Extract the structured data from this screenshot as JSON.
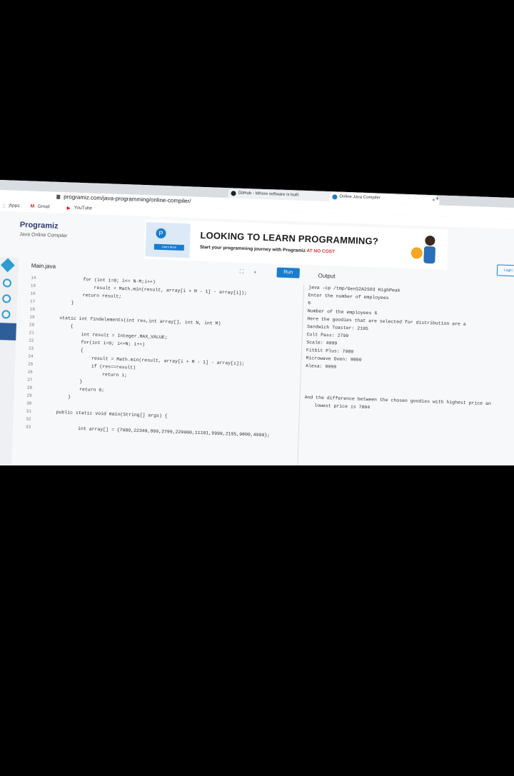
{
  "browser": {
    "tabs": [
      {
        "label": "GitHub - Where software is built"
      },
      {
        "label": "Online Java Compiler"
      }
    ],
    "url": "programiz.com/java-programming/online-compiler/",
    "bookmarks": [
      "Apps",
      "Gmail",
      "YouTube"
    ]
  },
  "site": {
    "logo": "Programiz",
    "subtitle": "Java Online Compiler",
    "banner": {
      "title": "LOOKING TO LEARN PROGRAMMING?",
      "subtitle": "Start your programming journey with Programiz",
      "subtitle_highlight": "AT NO COST",
      "button": "Learn More"
    },
    "login": "Login"
  },
  "editor": {
    "file_tab": "Main.java",
    "run_label": "Run",
    "output_label": "Output",
    "line_numbers": [
      "14",
      "15",
      "16",
      "17",
      "18",
      "19",
      "20",
      "21",
      "22",
      "23",
      "24",
      "25",
      "26",
      "27",
      "28",
      "29",
      "30",
      "31",
      "32",
      "33"
    ],
    "lines": [
      "        for (int i=0; i<= N-M;i++)",
      "            result = Math.min(result, array[i + M - 1] - array[i]);",
      "        return result;",
      "    }",
      "",
      "static int findelements(int res,int array[], int N, int M)",
      "    {",
      "        int result = Integer.MAX_VALUE;",
      "        for(int i=0; i<=N; i++)",
      "        {",
      "            result = Math.min(result, array[i + M - 1] - array[i]);",
      "            if (res==result)",
      "                return i;",
      "        }",
      "        return 0;",
      "    }",
      "",
      "public static void main(String[] args) {",
      "",
      "        int array[] = {7980,22349,999,2799,229900,11101,9999,2195,9800,4999};"
    ]
  },
  "output": {
    "lines": [
      "java -cp /tmp/GenS2A2SO3 HighPeak",
      "Enter the number of employees",
      "6",
      "Number of the employees 6",
      "Here the goodies that are selected for distribution are a",
      "Sandwich Toaster: 2195",
      "Cult Pass: 2799",
      "Scale: 4999",
      "Fitbit Plus: 7980",
      "Microwave Oven: 9800",
      "Alexa: 9999",
      "",
      "And the difference between the chosen goodies with highest price an",
      "lowest price is 7804"
    ]
  },
  "colors": {
    "accent": "#1b7ccf",
    "highlight": "#e03131",
    "page_bg": "#000000"
  }
}
